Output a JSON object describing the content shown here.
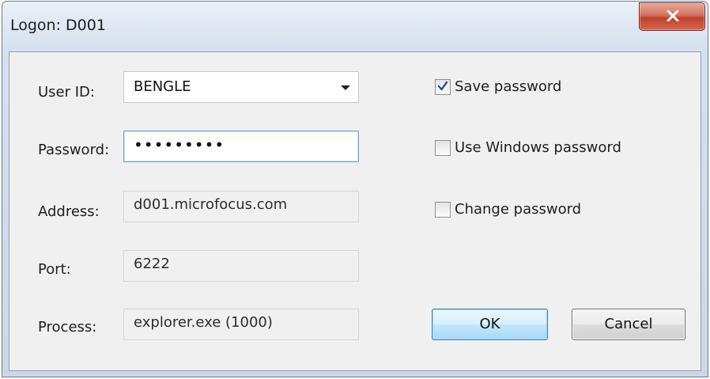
{
  "window": {
    "title": "Logon: D001"
  },
  "form": {
    "user_id_label": "User ID:",
    "user_id_value": "BENGLE",
    "password_label": "Password:",
    "password_masked": "•••••••••",
    "address_label": "Address:",
    "address_value": "d001.microfocus.com",
    "port_label": "Port:",
    "port_value": "6222",
    "process_label": "Process:",
    "process_value": "explorer.exe (1000)"
  },
  "options": {
    "save_password": {
      "label": "Save password",
      "checked": true
    },
    "use_windows_password": {
      "label": "Use Windows password",
      "checked": false
    },
    "change_password": {
      "label": "Change password",
      "checked": false
    }
  },
  "buttons": {
    "ok": "OK",
    "cancel": "Cancel"
  },
  "icons": {
    "close": "close-icon",
    "dropdown": "chevron-down-icon",
    "check": "checkmark-icon"
  },
  "colors": {
    "close_button": "#c0402a",
    "focus_border": "#6aa3d6",
    "default_button_border": "#3c7fb1"
  }
}
